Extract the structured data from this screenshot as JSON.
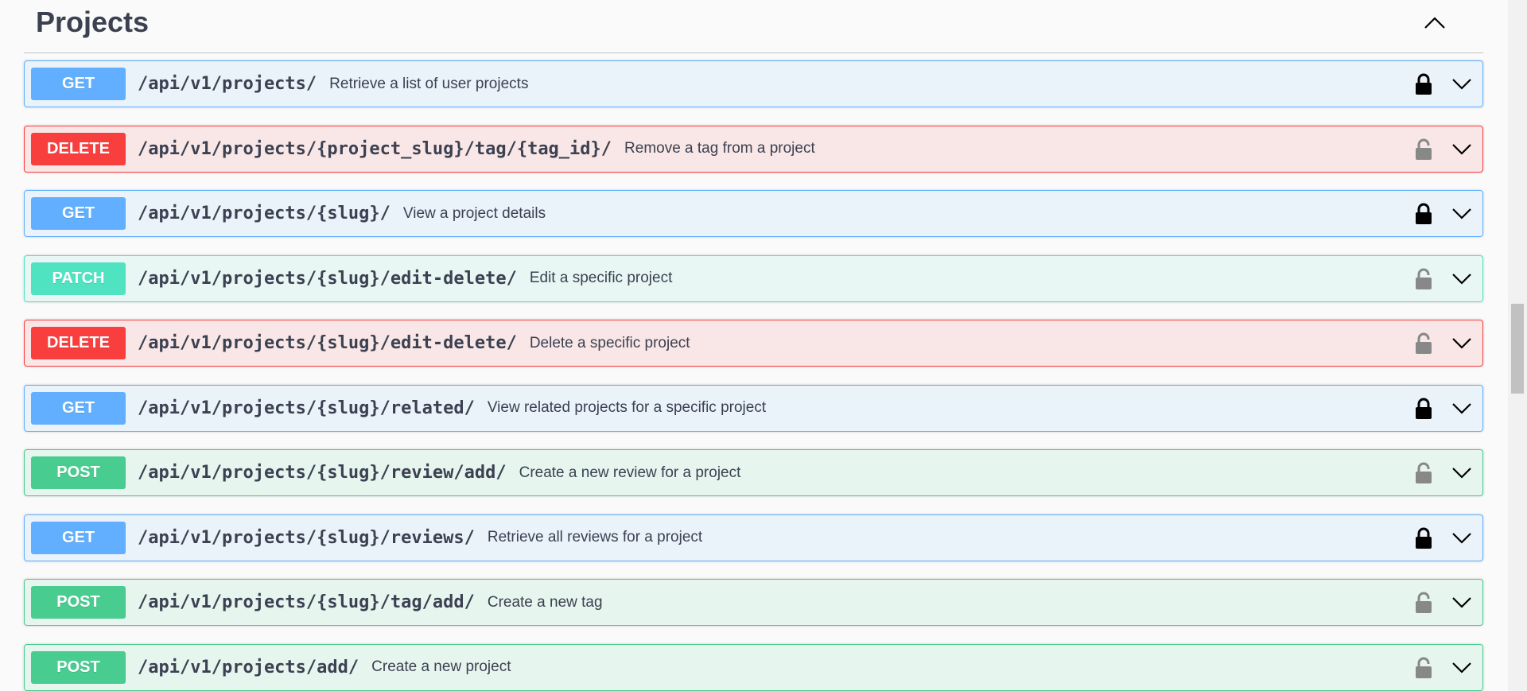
{
  "section": {
    "title": "Projects",
    "collapse_icon": "chevron-up-icon"
  },
  "operations": [
    {
      "method": "GET",
      "path": "/api/v1/projects/",
      "summary": "Retrieve a list of user projects",
      "locked": true
    },
    {
      "method": "DELETE",
      "path": "/api/v1/projects/{project_slug}/tag/{tag_id}/",
      "summary": "Remove a tag from a project",
      "locked": false
    },
    {
      "method": "GET",
      "path": "/api/v1/projects/{slug}/",
      "summary": "View a project details",
      "locked": true
    },
    {
      "method": "PATCH",
      "path": "/api/v1/projects/{slug}/edit-delete/",
      "summary": "Edit a specific project",
      "locked": false
    },
    {
      "method": "DELETE",
      "path": "/api/v1/projects/{slug}/edit-delete/",
      "summary": "Delete a specific project",
      "locked": false
    },
    {
      "method": "GET",
      "path": "/api/v1/projects/{slug}/related/",
      "summary": "View related projects for a specific project",
      "locked": true
    },
    {
      "method": "POST",
      "path": "/api/v1/projects/{slug}/review/add/",
      "summary": "Create a new review for a project",
      "locked": false
    },
    {
      "method": "GET",
      "path": "/api/v1/projects/{slug}/reviews/",
      "summary": "Retrieve all reviews for a project",
      "locked": true
    },
    {
      "method": "POST",
      "path": "/api/v1/projects/{slug}/tag/add/",
      "summary": "Create a new tag",
      "locked": false
    },
    {
      "method": "POST",
      "path": "/api/v1/projects/add/",
      "summary": "Create a new project",
      "locked": false
    }
  ],
  "colors": {
    "get": "#61affe",
    "delete": "#f93e3e",
    "patch": "#50e3c2",
    "post": "#49cc90",
    "text": "#3b4151",
    "lock_locked": "#000000",
    "lock_unlocked": "#888888"
  }
}
